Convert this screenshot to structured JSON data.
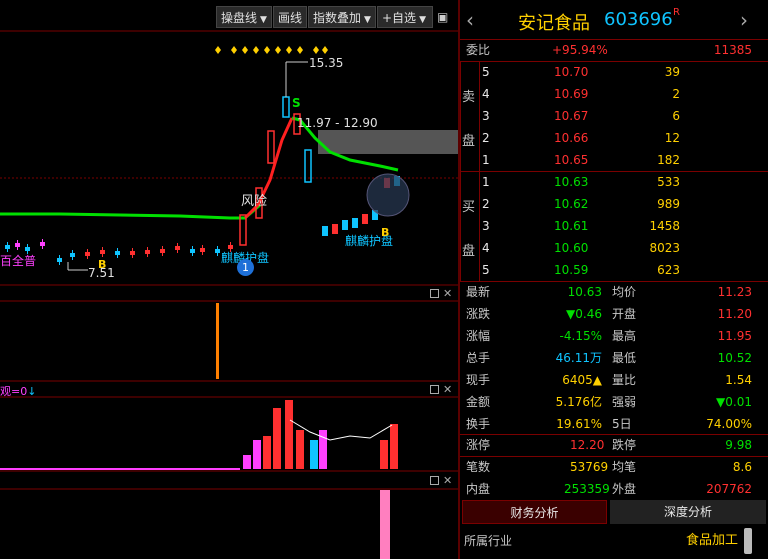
{
  "toolbar": {
    "pan_label": "操盘线",
    "draw_label": "画线",
    "index_label": "指数叠加",
    "watch_label": "+自选"
  },
  "chart": {
    "high_label": "15.35",
    "low_label": "7.51",
    "range_label": "11.97 - 12.90",
    "risk_label": "风险",
    "protect_label": "麒麟护盘",
    "b_label": "B",
    "s_label": "S",
    "circle_num": "1",
    "left_label": "百全普",
    "left_label2": "麒麟护盘",
    "note_label": "麒麟护盘",
    "indicator_label": "观=0",
    "indicator_arrow": "↓"
  },
  "stock": {
    "name": "安记食品",
    "code": "603696",
    "badge": "R",
    "prev_icon": "chevron-left",
    "next_icon": "chevron-right"
  },
  "wei": {
    "label": "委比",
    "pct": "+95.94%",
    "diff": "11385"
  },
  "sell_label": [
    "卖",
    "盘"
  ],
  "buy_label": [
    "买",
    "盘"
  ],
  "sell": [
    {
      "n": "5",
      "price": "10.70",
      "vol": "39"
    },
    {
      "n": "4",
      "price": "10.69",
      "vol": "2"
    },
    {
      "n": "3",
      "price": "10.67",
      "vol": "6"
    },
    {
      "n": "2",
      "price": "10.66",
      "vol": "12"
    },
    {
      "n": "1",
      "price": "10.65",
      "vol": "182"
    }
  ],
  "buy": [
    {
      "n": "1",
      "price": "10.63",
      "vol": "533"
    },
    {
      "n": "2",
      "price": "10.62",
      "vol": "989"
    },
    {
      "n": "3",
      "price": "10.61",
      "vol": "1458"
    },
    {
      "n": "4",
      "price": "10.60",
      "vol": "8023"
    },
    {
      "n": "5",
      "price": "10.59",
      "vol": "623"
    }
  ],
  "stats": [
    {
      "l1": "最新",
      "v1": "10.63",
      "c1": "green",
      "l2": "均价",
      "v2": "11.23",
      "c2": "red"
    },
    {
      "l1": "涨跌",
      "v1": "▼0.46",
      "c1": "green",
      "l2": "开盘",
      "v2": "11.20",
      "c2": "red"
    },
    {
      "l1": "涨幅",
      "v1": "-4.15%",
      "c1": "green",
      "l2": "最高",
      "v2": "11.95",
      "c2": "red"
    },
    {
      "l1": "总手",
      "v1": "46.11万",
      "c1": "cyan",
      "l2": "最低",
      "v2": "10.52",
      "c2": "green"
    },
    {
      "l1": "现手",
      "v1": "6405▲",
      "c1": "yellow",
      "l2": "量比",
      "v2": "1.54",
      "c2": "yellow"
    },
    {
      "l1": "金额",
      "v1": "5.176亿",
      "c1": "yellow",
      "l2": "强弱",
      "v2": "▼0.01",
      "c2": "green"
    },
    {
      "l1": "换手",
      "v1": "19.61%",
      "c1": "yellow",
      "l2": "5日",
      "v2": "74.00%",
      "c2": "yellow"
    }
  ],
  "limits": {
    "l1": "涨停",
    "v1": "12.20",
    "l2": "跌停",
    "v2": "9.98"
  },
  "trades": {
    "l1": "笔数",
    "v1": "53769",
    "l2": "均笔",
    "v2": "8.6"
  },
  "inout": {
    "l1": "内盘",
    "v1": "253359",
    "l2": "外盘",
    "v2": "207762"
  },
  "tabs": {
    "fin": "财务分析",
    "depth": "深度分析"
  },
  "industry": {
    "label": "所属行业",
    "value": "食品加工"
  },
  "colors": {
    "up": "#ff3030",
    "down": "#00e000",
    "accent": "#ffd000",
    "info": "#0fc4ff"
  }
}
